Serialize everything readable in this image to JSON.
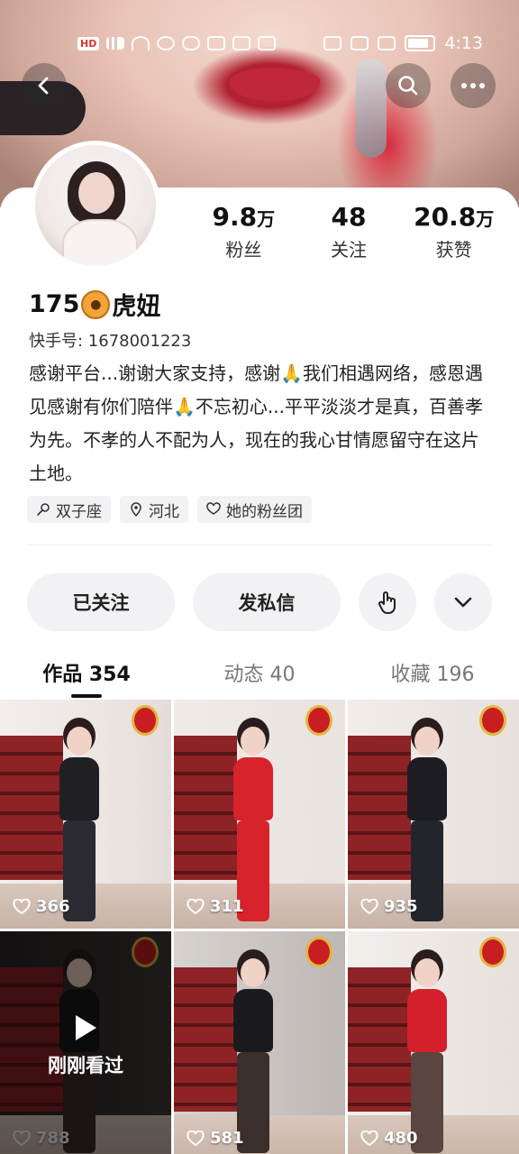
{
  "status_bar": {
    "time": "4:13",
    "badge": "HD"
  },
  "profile": {
    "name_prefix": "175",
    "name_suffix": "虎妞",
    "kuaishou_id": "快手号: 1678001223",
    "bio": "感谢平台...谢谢大家支持，感谢🙏我们相遇网络，感恩遇见感谢有你们陪伴🙏不忘初心...平平淡淡才是真，百善孝为先。不孝的人不配为人，现在的我心甘情愿留守在这片土地。",
    "stats": [
      {
        "num": "9.8",
        "unit": "万",
        "label": "粉丝"
      },
      {
        "num": "48",
        "unit": "",
        "label": "关注"
      },
      {
        "num": "20.8",
        "unit": "万",
        "label": "获赞"
      }
    ],
    "tags": [
      {
        "icon": "zodiac-icon",
        "label": "双子座"
      },
      {
        "icon": "location-pin-icon",
        "label": "河北"
      },
      {
        "icon": "fan-club-icon",
        "label": "她的粉丝团"
      }
    ]
  },
  "actions": {
    "follow_label": "已关注",
    "message_label": "发私信"
  },
  "tabs": [
    {
      "label": "作品 354",
      "active": true
    },
    {
      "label": "动态 40",
      "active": false
    },
    {
      "label": "收藏 196",
      "active": false
    }
  ],
  "videos": [
    {
      "likes": "366",
      "outfit": "#1f1f24",
      "legs": "#2a2a30"
    },
    {
      "likes": "311",
      "outfit": "#d8232a",
      "legs": "#d8232a"
    },
    {
      "likes": "935",
      "outfit": "#1c1c22",
      "legs": "#22252c"
    },
    {
      "likes": "788",
      "outfit": "#1a1a1a",
      "legs": "#3a2e2c",
      "recent_label": "刚刚看过"
    },
    {
      "likes": "581",
      "outfit": "#1a1a1e",
      "legs": "#3b2f2c"
    },
    {
      "likes": "480",
      "outfit": "#d51f2b",
      "legs": "#5a4540"
    }
  ]
}
